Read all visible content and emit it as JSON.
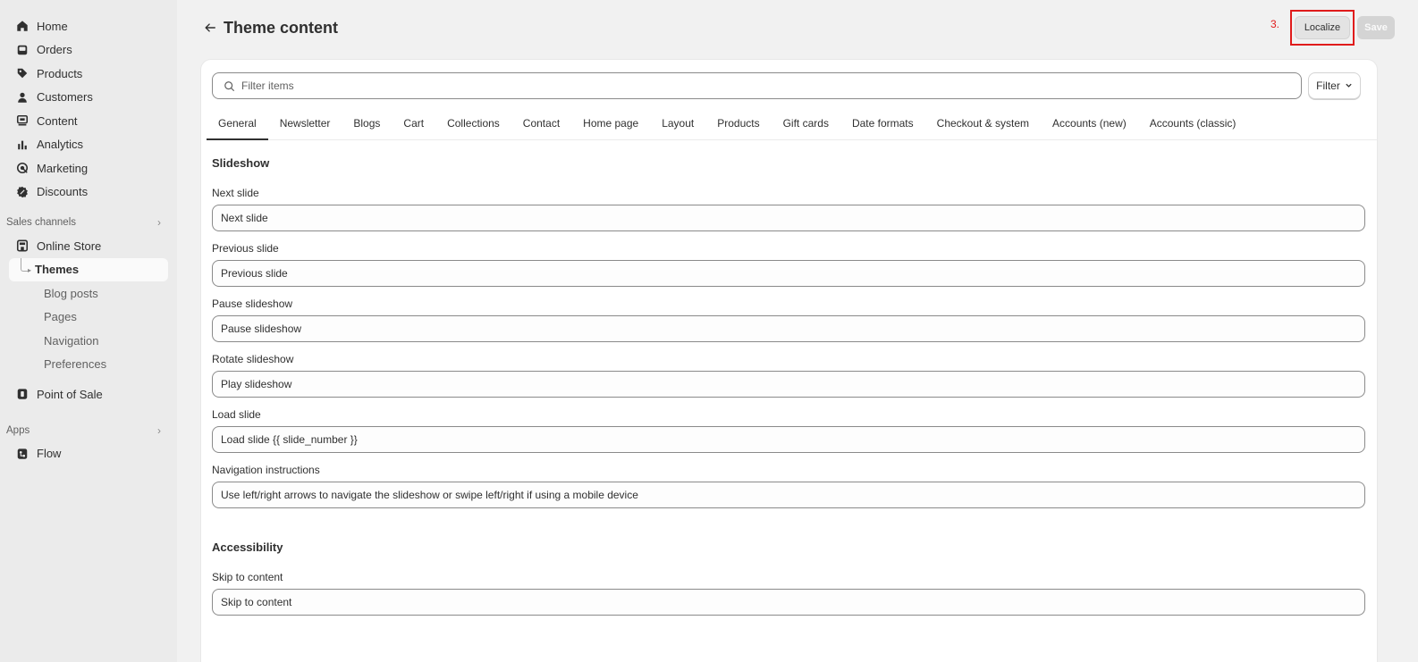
{
  "sidebar": {
    "main_items": [
      {
        "label": "Home",
        "icon": "home-icon"
      },
      {
        "label": "Orders",
        "icon": "inbox-icon"
      },
      {
        "label": "Products",
        "icon": "tag-icon"
      },
      {
        "label": "Customers",
        "icon": "person-icon"
      },
      {
        "label": "Content",
        "icon": "content-icon"
      },
      {
        "label": "Analytics",
        "icon": "bar-chart-icon"
      },
      {
        "label": "Marketing",
        "icon": "target-icon"
      },
      {
        "label": "Discounts",
        "icon": "discount-icon"
      }
    ],
    "sales_channels_label": "Sales channels",
    "online_store_label": "Online Store",
    "online_store_sub": [
      "Themes",
      "Blog posts",
      "Pages",
      "Navigation",
      "Preferences"
    ],
    "pos_label": "Point of Sale",
    "apps_label": "Apps",
    "flow_label": "Flow"
  },
  "header": {
    "title": "Theme content",
    "annotation": "3.",
    "localize_label": "Localize",
    "save_label": "Save"
  },
  "filter": {
    "placeholder": "Filter items",
    "button_label": "Filter"
  },
  "tabs": [
    "General",
    "Newsletter",
    "Blogs",
    "Cart",
    "Collections",
    "Contact",
    "Home page",
    "Layout",
    "Products",
    "Gift cards",
    "Date formats",
    "Checkout & system",
    "Accounts (new)",
    "Accounts (classic)"
  ],
  "sections": {
    "slideshow": {
      "title": "Slideshow",
      "fields": [
        {
          "label": "Next slide",
          "value": "Next slide"
        },
        {
          "label": "Previous slide",
          "value": "Previous slide"
        },
        {
          "label": "Pause slideshow",
          "value": "Pause slideshow"
        },
        {
          "label": "Rotate slideshow",
          "value": "Play slideshow"
        },
        {
          "label": "Load slide",
          "value": "Load slide {{ slide_number }}"
        },
        {
          "label": "Navigation instructions",
          "value": "Use left/right arrows to navigate the slideshow or swipe left/right if using a mobile device"
        }
      ]
    },
    "accessibility": {
      "title": "Accessibility",
      "fields": [
        {
          "label": "Skip to content",
          "value": "Skip to content"
        }
      ]
    }
  },
  "colors": {
    "annotation_red": "#e01b1b",
    "sidebar_bg": "#ebebeb",
    "page_bg": "#f1f1f1"
  }
}
